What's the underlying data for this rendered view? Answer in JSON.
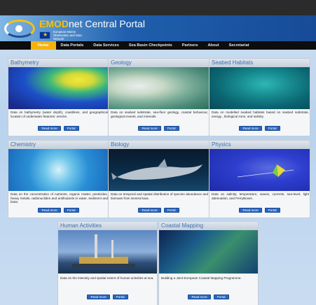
{
  "header": {
    "brand_prefix": "EMOD",
    "brand_rest": "net Central Portal",
    "eu_network_text": "European Marine Observation and Data Network"
  },
  "nav": {
    "items": [
      "Home",
      "Data Portals",
      "Data Services",
      "Sea Basin Checkpoints",
      "Partners",
      "About",
      "Secretariat"
    ],
    "active_index": 0
  },
  "buttons": {
    "read_more": "Read more",
    "portal": "Portal"
  },
  "panels": [
    {
      "title": "Bathymetry",
      "desc": "Data on bathymetry (water depth), coastlines, and geographical location of underwater features: wrecks."
    },
    {
      "title": "Geology",
      "desc": "Data on seabed substrate, sea-floor geology, coastal behaviour, geological events, and minerals."
    },
    {
      "title": "Seabed Habitats",
      "desc": "Data on modelled seabed habitats based on seabed substrate, energy , biological zone, and salinity."
    },
    {
      "title": "Chemistry",
      "desc": "Data on the concentration of nutrients, organic matter, pesticides, heavy metals, radionuclides and antifoulants in water, sediment and biota."
    },
    {
      "title": "Biology",
      "desc": "Data on temporal and spatial distribution of species abundance and biomass from several taxa."
    },
    {
      "title": "Physics",
      "desc": "Data on salinity, temperature, waves, currents, sea-level, light attenuation, and FerryBoxes."
    },
    {
      "title": "Human Activities",
      "desc": "Data on the intensity and spatial extent of human activities at sea."
    },
    {
      "title": "Coastal Mapping",
      "desc": "Building a Joint European Coastal Mapping Programme."
    }
  ]
}
